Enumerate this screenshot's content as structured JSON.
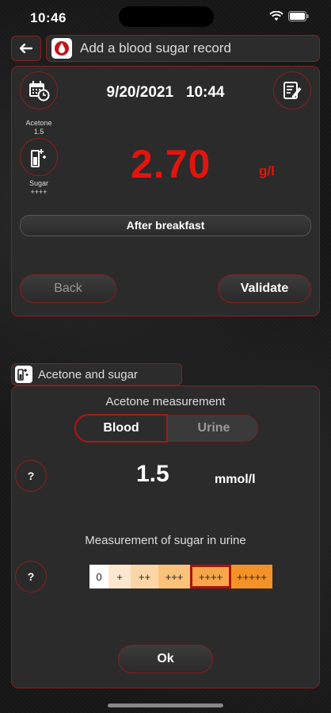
{
  "status_bar": {
    "time": "10:46"
  },
  "header": {
    "title": "Add a blood sugar record",
    "back_icon": "arrow-left-icon",
    "title_icon": "blood-drop-icon"
  },
  "record": {
    "date": "9/20/2021",
    "time": "10:44",
    "acetone_caption": "Acetone",
    "acetone_value": "1.5",
    "sugar_caption": "Sugar",
    "sugar_value": "++++",
    "glucose_value": "2.70",
    "glucose_unit": "g/l",
    "meal": "After breakfast",
    "back_label": "Back",
    "validate_label": "Validate"
  },
  "acetone_section": {
    "tab_label": "Acetone and sugar",
    "acetone_title": "Acetone measurement",
    "mode_options": [
      "Blood",
      "Urine"
    ],
    "mode_selected": "Blood",
    "help_label": "?",
    "acetone_value": "1.5",
    "acetone_unit": "mmol/l",
    "sugar_title": "Measurement of sugar in urine",
    "sugar_scale": [
      {
        "label": "0",
        "color": "#ffffff"
      },
      {
        "label": "+",
        "color": "#fde8cf"
      },
      {
        "label": "++",
        "color": "#fcd6a6"
      },
      {
        "label": "+++",
        "color": "#fbc27a"
      },
      {
        "label": "++++",
        "color": "#f9a64a"
      },
      {
        "label": "+++++",
        "color": "#f59227"
      }
    ],
    "sugar_selected": "++++",
    "ok_label": "Ok"
  },
  "colors": {
    "accent_red": "#e3140e",
    "border_red": "#8a1f1f"
  }
}
